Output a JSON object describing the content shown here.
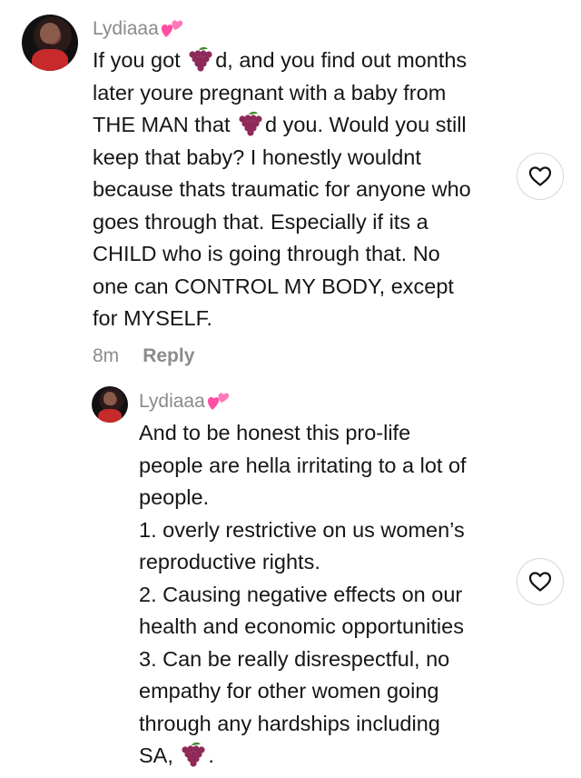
{
  "comment": {
    "username": "Lydiaaa",
    "username_emoji": "pink-hearts-emoji",
    "lines": [
      [
        "If you got ",
        "grape",
        "d, and you find out months"
      ],
      [
        "later youre pregnant with a baby from"
      ],
      [
        "THE MAN that ",
        "grape",
        "d you. Would you still"
      ],
      [
        "keep that baby? I honestly wouldnt"
      ],
      [
        "because thats traumatic for anyone who"
      ],
      [
        "goes through that. Especially if its a"
      ],
      [
        "CHILD who is going through that.  No"
      ],
      [
        "one can  CONTROL MY BODY, except"
      ],
      [
        "for MYSELF."
      ]
    ],
    "time": "8m",
    "reply_label": "Reply",
    "like_icon": "heart-outline-icon"
  },
  "reply": {
    "username": "Lydiaaa",
    "username_emoji": "pink-hearts-emoji",
    "lines": [
      [
        "And to be honest this pro-life"
      ],
      [
        "people are hella irritating to a lot of"
      ],
      [
        "people."
      ],
      [
        "1. overly restrictive on us women’s"
      ],
      [
        "reproductive rights."
      ],
      [
        "2. Causing negative effects on our"
      ],
      [
        "health and economic opportunities"
      ],
      [
        "3. Can be really disrespectful, no"
      ],
      [
        "empathy for other women going"
      ],
      [
        "through any hardships including"
      ],
      [
        "SA, ",
        "grape",
        "."
      ]
    ],
    "like_icon": "heart-outline-icon"
  },
  "colors": {
    "username": "#8a8a8a",
    "text": "#161616",
    "meta": "#8c8c8c",
    "grape": "#8e2a5a",
    "heart_emoji": "#ff4fa3"
  }
}
